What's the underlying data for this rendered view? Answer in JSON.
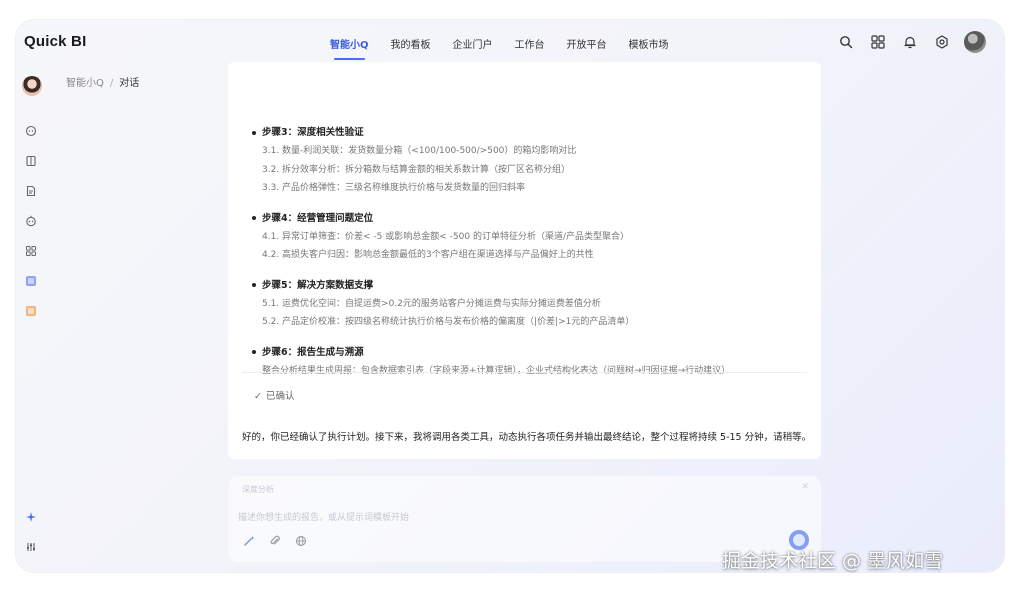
{
  "app": {
    "logo": "Quick BI"
  },
  "nav": {
    "items": [
      {
        "label": "智能小Q",
        "active": true
      },
      {
        "label": "我的看板",
        "active": false
      },
      {
        "label": "企业门户",
        "active": false
      },
      {
        "label": "工作台",
        "active": false
      },
      {
        "label": "开放平台",
        "active": false
      },
      {
        "label": "模板市场",
        "active": false
      }
    ]
  },
  "header_icons": [
    "search-icon",
    "apps-grid-icon",
    "bell-icon",
    "gear-icon",
    "user-avatar"
  ],
  "rail_icons": [
    "chat-icon",
    "book-icon",
    "document-icon",
    "bot-icon",
    "grid-icon",
    "image-icon",
    "gift-icon",
    "sparkle-icon",
    "sliders-icon"
  ],
  "breadcrumb": {
    "root": "智能小Q",
    "separator": "/",
    "current": "对话"
  },
  "plan": {
    "steps": [
      {
        "title": "步骤3：深度相关性验证",
        "lines": [
          "3.1. 数量-利润关联：发货数量分箱（<100/100-500/>500）的箱均影响对比",
          "3.2. 拆分效率分析：拆分箱数与结算金额的相关系数计算（按厂区名称分组）",
          "3.3. 产品价格弹性：三级名称维度执行价格与发货数量的回归斜率"
        ]
      },
      {
        "title": "步骤4：经营管理问题定位",
        "lines": [
          "4.1. 异常订单筛查：价差< -5 或影响总金额< -500 的订单特征分析（渠道/产品类型聚合）",
          "4.2. 高损失客户归因：影响总金额最低的3个客户组在渠道选择与产品偏好上的共性"
        ]
      },
      {
        "title": "步骤5：解决方案数据支撑",
        "lines": [
          "5.1. 运费优化空间：自提运费>0.2元的服务站客户分摊运费与实际分摊运费差值分析",
          "5.2. 产品定价校准：按四级名称统计执行价格与发布价格的偏离度（|价差|>1元的产品清单）"
        ]
      },
      {
        "title": "步骤6：报告生成与溯源",
        "lines": [
          "整合分析结果生成周报：包含数据索引表（字段来源+计算逻辑），企业式结构化表达（问题树→归因证据→行动建议）"
        ]
      }
    ],
    "confirmed_label": "已确认"
  },
  "final_message": "好的，你已经确认了执行计划。接下来，我将调用各类工具，动态执行各项任务并输出最终结论，整个过程将持续 5-15 分钟，请稍等。",
  "input": {
    "mode_badge": "深度分析",
    "placeholder": "描述你想生成的报告，或从提示词模板开始"
  },
  "watermark": "掘金技术社区 @ 墨风如雪",
  "colors": {
    "accent": "#4c6ef5",
    "background": "#f3f4f9",
    "card": "#ffffff"
  }
}
